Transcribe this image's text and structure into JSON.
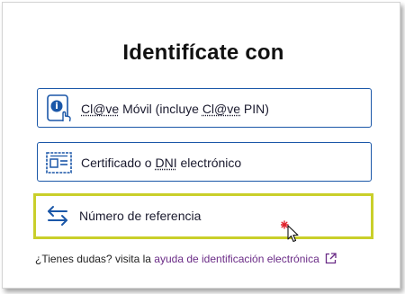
{
  "heading": "Identifícate con",
  "options": [
    {
      "label_parts": [
        "Cl@ve",
        " Móvil (incluye ",
        "Cl@ve",
        " PIN)"
      ],
      "icon": "mobile-touch-icon"
    },
    {
      "label_parts": [
        "Certificado o ",
        "DNI",
        " electrónico"
      ],
      "icon": "id-card-icon"
    },
    {
      "label": "Número de referencia",
      "icon": "swap-arrows-icon"
    }
  ],
  "help": {
    "prefix": "¿Tienes dudas? visita la ",
    "link": "ayuda de identificación electrónica",
    "icon": "external-link-icon"
  },
  "colors": {
    "primary": "#1b57a8",
    "highlight": "#c9cf2a",
    "link": "#6a2b86",
    "cursor_click": "#e0202a"
  }
}
